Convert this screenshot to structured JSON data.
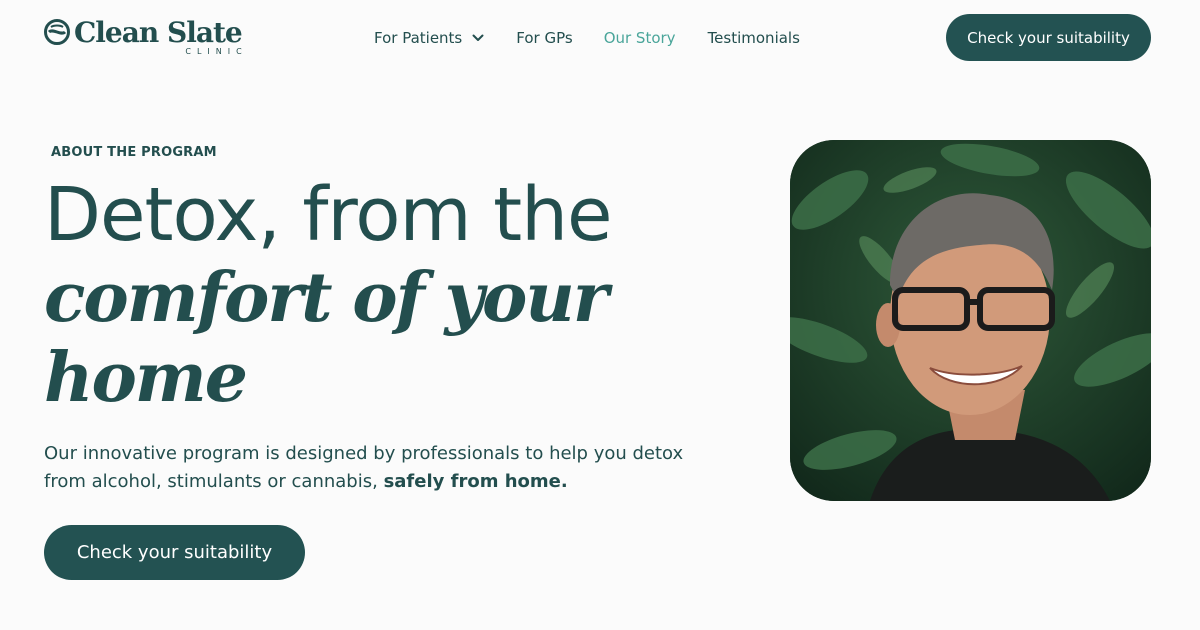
{
  "brand": {
    "name": "Clean Slate",
    "sub": "CLINIC",
    "icon": "clean-slate-logo-icon"
  },
  "nav": {
    "items": [
      {
        "label": "For Patients",
        "has_dropdown": true
      },
      {
        "label": "For GPs",
        "has_dropdown": false
      },
      {
        "label": "Our Story",
        "active": true
      },
      {
        "label": "Testimonials",
        "has_dropdown": false
      }
    ],
    "cta_label": "Check your suitability"
  },
  "hero": {
    "eyebrow": "ABOUT THE PROGRAM",
    "headline_line1": "Detox, from the",
    "headline_line2": "comfort of your",
    "headline_line3": "home",
    "description_text": "Our innovative program is designed by professionals to help you detox from alcohol, stimulants or cannabis, ",
    "description_bold": "safely from home.",
    "cta_label": "Check your suitability",
    "image_alt": "portrait-photo"
  },
  "colors": {
    "primary": "#235252",
    "text": "#234e4e",
    "active_nav": "#4aa59a",
    "background": "#fbfbfb"
  }
}
